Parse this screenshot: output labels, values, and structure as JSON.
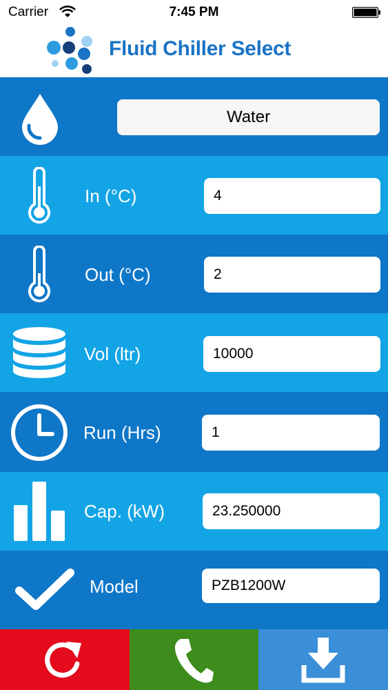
{
  "status_bar": {
    "carrier": "Carrier",
    "time": "7:45 PM"
  },
  "header": {
    "title": "Fluid Chiller Select"
  },
  "fluid": {
    "value": "Water"
  },
  "fields": {
    "in": {
      "label": "In (°C)",
      "value": "4"
    },
    "out": {
      "label": "Out (°C)",
      "value": "2"
    },
    "vol": {
      "label": "Vol (ltr)",
      "value": "10000"
    },
    "run": {
      "label": "Run (Hrs)",
      "value": "1"
    },
    "cap": {
      "label": "Cap. (kW)",
      "value": "23.250000"
    },
    "model": {
      "label": "Model",
      "value": "PZB1200W"
    }
  },
  "icons": {
    "fluid": "water-drop-icon",
    "in": "thermometer-icon",
    "out": "thermometer-icon",
    "vol": "database-icon",
    "run": "clock-icon",
    "cap": "bar-chart-icon",
    "model": "checkmark-icon",
    "reset": "refresh-icon",
    "call": "phone-icon",
    "download": "download-icon"
  },
  "colors": {
    "title": "#1a73c4",
    "row_dark": "#0f77c8",
    "row_light": "#13a4e6",
    "reset": "#e30b1c",
    "call": "#3e8d1c",
    "download": "#3a8fd8"
  }
}
